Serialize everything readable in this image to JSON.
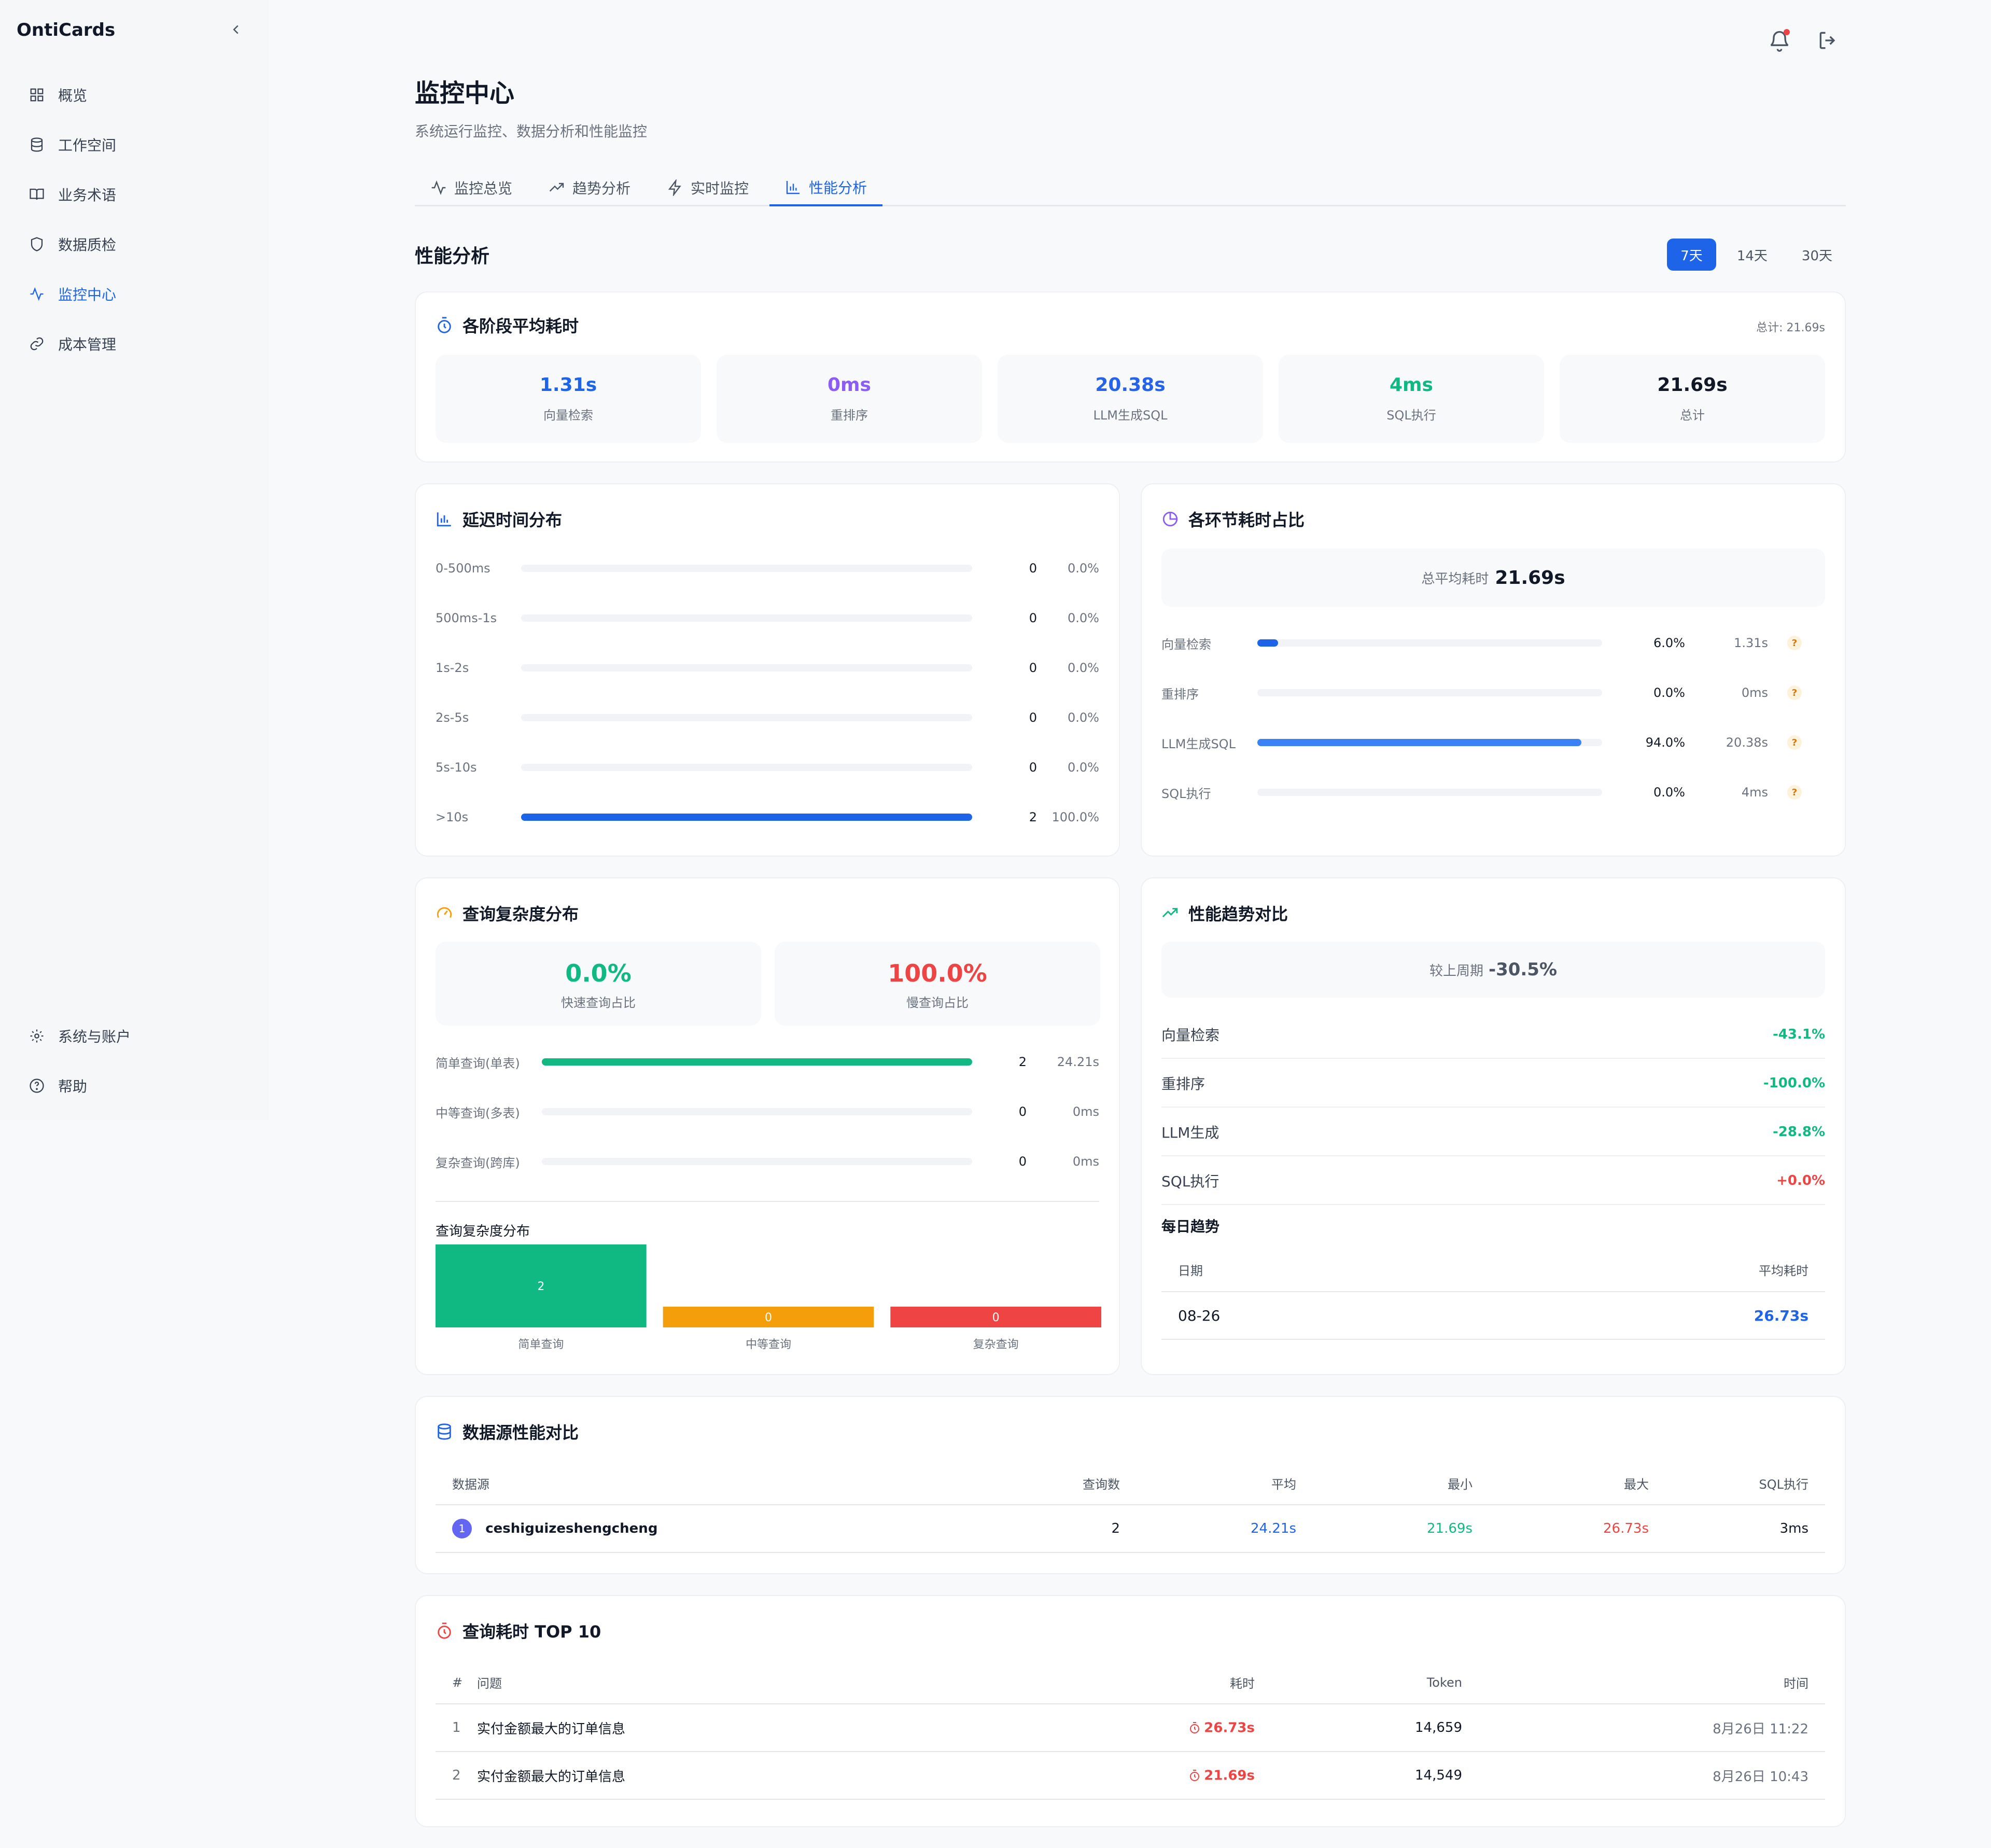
{
  "app": {
    "brand": "OntiCards"
  },
  "sidebar": {
    "items": [
      {
        "label": "概览",
        "icon": "grid-icon"
      },
      {
        "label": "工作空间",
        "icon": "database-icon"
      },
      {
        "label": "业务术语",
        "icon": "book-icon"
      },
      {
        "label": "数据质检",
        "icon": "shield-icon"
      },
      {
        "label": "监控中心",
        "icon": "activity-icon",
        "active": true
      },
      {
        "label": "成本管理",
        "icon": "link-icon"
      }
    ],
    "bottom": [
      {
        "label": "系统与账户",
        "icon": "gear-icon"
      },
      {
        "label": "帮助",
        "icon": "help-icon"
      }
    ]
  },
  "page": {
    "title": "监控中心",
    "subtitle": "系统运行监控、数据分析和性能监控"
  },
  "tabs": [
    {
      "label": "监控总览",
      "icon": "activity-icon"
    },
    {
      "label": "趋势分析",
      "icon": "trending-up-icon"
    },
    {
      "label": "实时监控",
      "icon": "zap-icon"
    },
    {
      "label": "性能分析",
      "icon": "bar-chart-icon",
      "active": true
    }
  ],
  "section": {
    "title": "性能分析",
    "ranges": [
      "7天",
      "14天",
      "30天"
    ],
    "selected_range": "7天"
  },
  "stage_avg": {
    "title": "各阶段平均耗时",
    "total_label": "总计: 21.69s",
    "stats": [
      {
        "value": "1.31s",
        "label": "向量检索",
        "color": "#1d64e8"
      },
      {
        "value": "0ms",
        "label": "重排序",
        "color": "#8b5cf6"
      },
      {
        "value": "20.38s",
        "label": "LLM生成SQL",
        "color": "#2563eb"
      },
      {
        "value": "4ms",
        "label": "SQL执行",
        "color": "#10b981"
      },
      {
        "value": "21.69s",
        "label": "总计",
        "color": "#111827"
      }
    ]
  },
  "latency": {
    "title": "延迟时间分布",
    "rows": [
      {
        "label": "0-500ms",
        "count": "0",
        "pct": "0.0%",
        "frac": 0
      },
      {
        "label": "500ms-1s",
        "count": "0",
        "pct": "0.0%",
        "frac": 0
      },
      {
        "label": "1s-2s",
        "count": "0",
        "pct": "0.0%",
        "frac": 0
      },
      {
        "label": "2s-5s",
        "count": "0",
        "pct": "0.0%",
        "frac": 0
      },
      {
        "label": "5s-10s",
        "count": "0",
        "pct": "0.0%",
        "frac": 0
      },
      {
        "label": ">10s",
        "count": "2",
        "pct": "100.0%",
        "frac": 1
      }
    ]
  },
  "stage_share": {
    "title": "各环节耗时占比",
    "total_label": "总平均耗时",
    "total_value": "21.69s",
    "rows": [
      {
        "label": "向量检索",
        "pct": "6.0%",
        "time": "1.31s",
        "frac": 0.06,
        "color": "#1d64e8"
      },
      {
        "label": "重排序",
        "pct": "0.0%",
        "time": "0ms",
        "frac": 0,
        "color": "#8b5cf6"
      },
      {
        "label": "LLM生成SQL",
        "pct": "94.0%",
        "time": "20.38s",
        "frac": 0.94,
        "color": "#3b82f6"
      },
      {
        "label": "SQL执行",
        "pct": "0.0%",
        "time": "4ms",
        "frac": 0,
        "color": "#10b981"
      }
    ]
  },
  "complexity": {
    "title": "查询复杂度分布",
    "fast": {
      "value": "0.0%",
      "label": "快速查询占比"
    },
    "slow": {
      "value": "100.0%",
      "label": "慢查询占比"
    },
    "rows": [
      {
        "label": "简单查询(单表)",
        "count": "2",
        "time": "24.21s",
        "frac": 1
      },
      {
        "label": "中等查询(多表)",
        "count": "0",
        "time": "0ms",
        "frac": 0
      },
      {
        "label": "复杂查询(跨库)",
        "count": "0",
        "time": "0ms",
        "frac": 0
      }
    ],
    "chart_title": "查询复杂度分布"
  },
  "chart_data": {
    "type": "bar",
    "title": "查询复杂度分布",
    "categories": [
      "简单查询",
      "中等查询",
      "复杂查询"
    ],
    "values": [
      2,
      0,
      0
    ],
    "colors": [
      "#10b981",
      "#f59e0b",
      "#ef4444"
    ]
  },
  "trend": {
    "title": "性能趋势对比",
    "compare_label": "较上周期",
    "compare_value": "-30.5%",
    "rows": [
      {
        "label": "向量检索",
        "value": "-43.1%",
        "dir": "neg"
      },
      {
        "label": "重排序",
        "value": "-100.0%",
        "dir": "neg"
      },
      {
        "label": "LLM生成",
        "value": "-28.8%",
        "dir": "neg"
      },
      {
        "label": "SQL执行",
        "value": "+0.0%",
        "dir": "pos"
      }
    ],
    "daily_title": "每日趋势",
    "daily_headers": [
      "日期",
      "平均耗时"
    ],
    "daily_rows": [
      {
        "date": "08-26",
        "avg": "26.73s"
      }
    ]
  },
  "datasource": {
    "title": "数据源性能对比",
    "headers": [
      "数据源",
      "查询数",
      "平均",
      "最小",
      "最大",
      "SQL执行"
    ],
    "rows": [
      {
        "rank": "1",
        "name": "ceshiguizeshengcheng",
        "count": "2",
        "avg": "24.21s",
        "min": "21.69s",
        "max": "26.73s",
        "sql": "3ms"
      }
    ]
  },
  "top10": {
    "title": "查询耗时 TOP 10",
    "headers": [
      "#",
      "问题",
      "耗时",
      "Token",
      "时间"
    ],
    "rows": [
      {
        "idx": "1",
        "question": "实付金额最大的订单信息",
        "time": "26.73s",
        "tokens": "14,659",
        "at": "8月26日 11:22"
      },
      {
        "idx": "2",
        "question": "实付金额最大的订单信息",
        "time": "21.69s",
        "tokens": "14,549",
        "at": "8月26日 10:43"
      }
    ]
  }
}
